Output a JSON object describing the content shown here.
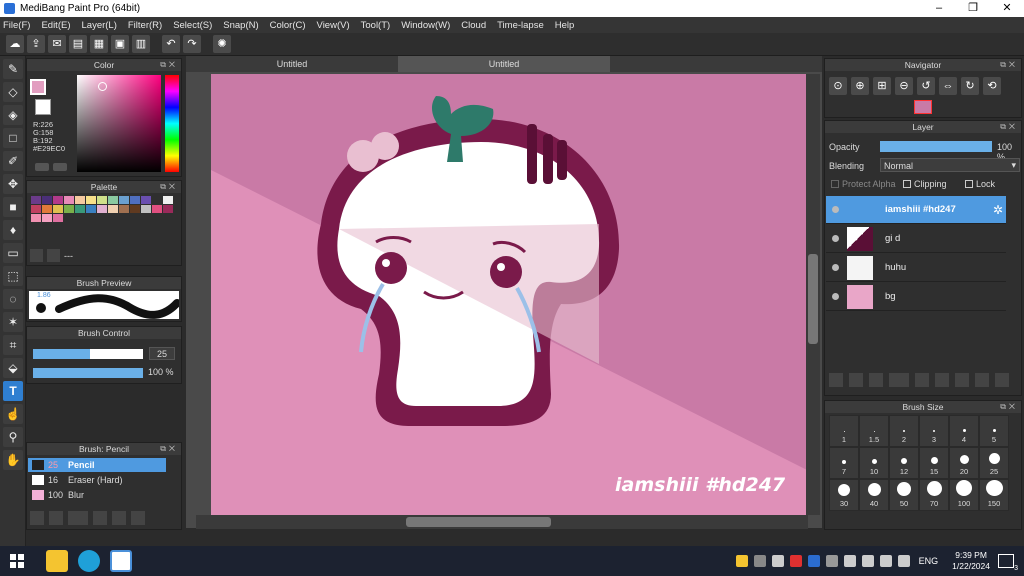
{
  "window": {
    "title": "MediBang Paint Pro (64bit)",
    "controls": [
      "–",
      "❐",
      "✕"
    ]
  },
  "menu": [
    "File(F)",
    "Edit(E)",
    "Layer(L)",
    "Filter(R)",
    "Select(S)",
    "Snap(N)",
    "Color(C)",
    "View(V)",
    "Tool(T)",
    "Window(W)",
    "Cloud",
    "Time-lapse",
    "Help"
  ],
  "doc_tabs": [
    "Untitled",
    "Untitled"
  ],
  "color_panel": {
    "title": "Color",
    "r": "R:226",
    "g": "G:158",
    "b": "B:192",
    "hex": "#E29EC0",
    "main_color": "#E29EC0"
  },
  "palette_panel": {
    "title": "Palette",
    "label": "---",
    "colors": [
      "#6b3b8a",
      "#4a2f78",
      "#b23a8a",
      "#e88ab8",
      "#f5c9a0",
      "#f7e08a",
      "#cfe08a",
      "#8ac9a0",
      "#6aa0d0",
      "#4f6fc0",
      "#6a4fb0",
      "#2f2f2f",
      "#f0f0f0",
      "#c04060",
      "#e07a3a",
      "#e0c050",
      "#7ab04a",
      "#3a9a7a",
      "#3a80c0",
      "#e0b0d0",
      "#f0d0b0",
      "#a07050",
      "#603a20",
      "#c0c0c0",
      "#e05080",
      "#9a2a5a",
      "#f090b0",
      "#f4a0c0",
      "#e070a0"
    ]
  },
  "brush_preview": {
    "title": "Brush Preview",
    "size_label": "1.86"
  },
  "brush_control": {
    "title": "Brush Control",
    "size": "25",
    "opacity": "100",
    "opacity_unit": "%"
  },
  "brush_list": {
    "title": "Brush: Pencil",
    "items": [
      {
        "size": "25",
        "name": "Pencil",
        "selected": true
      },
      {
        "size": "16",
        "name": "Eraser (Hard)",
        "selected": false
      },
      {
        "size": "100",
        "name": "Blur",
        "selected": false
      }
    ]
  },
  "navigator": {
    "title": "Navigator"
  },
  "layer_panel": {
    "title": "Layer",
    "opacity_label": "Opacity",
    "opacity_value": "100 %",
    "blending_label": "Blending",
    "blending_value": "Normal",
    "protect_alpha": "Protect Alpha",
    "clipping": "Clipping",
    "lock": "Lock",
    "layers": [
      {
        "name": "iamshiii #hd247",
        "selected": true
      },
      {
        "name": "gi d",
        "selected": false
      },
      {
        "name": "huhu",
        "selected": false
      },
      {
        "name": "bg",
        "selected": false
      }
    ]
  },
  "brush_size": {
    "title": "Brush Size",
    "sizes": [
      "1",
      "1.5",
      "2",
      "3",
      "4",
      "5",
      "7",
      "10",
      "12",
      "15",
      "20",
      "25",
      "30",
      "40",
      "50",
      "70",
      "100",
      "150"
    ]
  },
  "artwork": {
    "watermark": "iamshiii #hd247",
    "background": "#c97aa6"
  },
  "taskbar": {
    "language": "ENG",
    "time": "9:39 PM",
    "date": "1/22/2024",
    "notifications": "3"
  }
}
